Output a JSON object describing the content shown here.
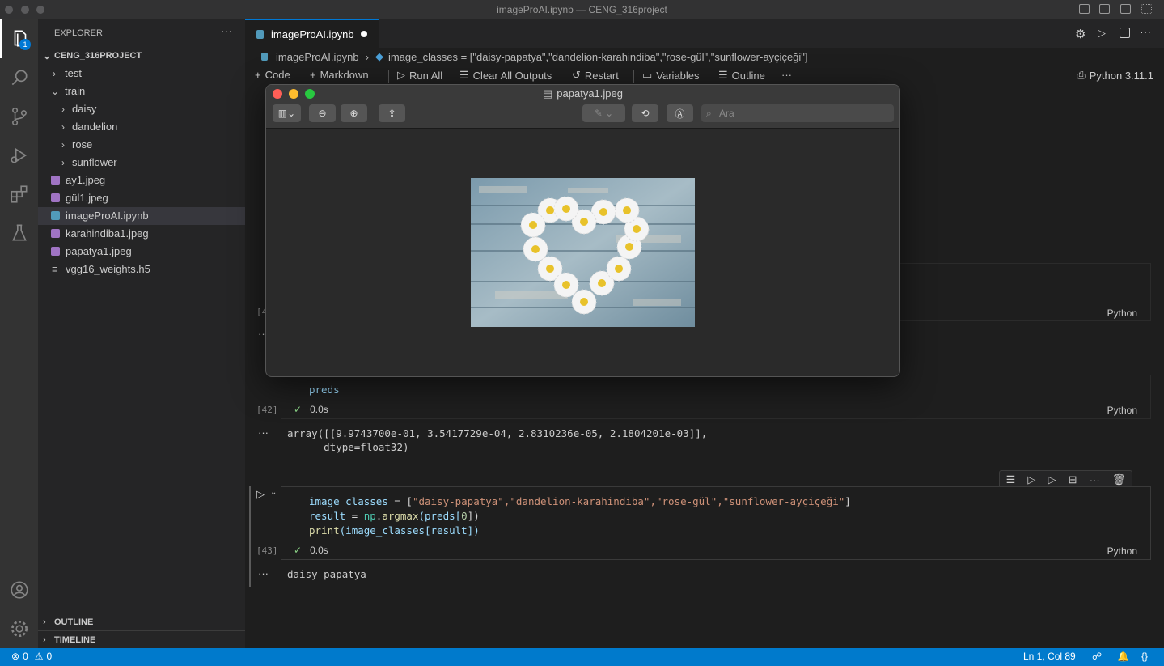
{
  "window": {
    "title": "imageProAI.ipynb — CENG_316project"
  },
  "activity": {
    "explorer_badge": "1"
  },
  "sidebar": {
    "header": "EXPLORER",
    "more": "···",
    "project": "CENG_316PROJECT",
    "items": [
      {
        "label": "test"
      },
      {
        "label": "train"
      },
      {
        "label": "daisy"
      },
      {
        "label": "dandelion"
      },
      {
        "label": "rose"
      },
      {
        "label": "sunflower"
      },
      {
        "label": "ay1.jpeg"
      },
      {
        "label": "gül1.jpeg"
      },
      {
        "label": "imageProAI.ipynb"
      },
      {
        "label": "karahindiba1.jpeg"
      },
      {
        "label": "papatya1.jpeg"
      },
      {
        "label": "vgg16_weights.h5"
      }
    ],
    "outline": "OUTLINE",
    "timeline": "TIMELINE"
  },
  "tab": {
    "label": "imageProAI.ipynb"
  },
  "breadcrumb": {
    "file": "imageProAI.ipynb",
    "symbol": "image_classes = [\"daisy-papatya\",\"dandelion-karahindiba\",\"rose-gül\",\"sunflower-ayçiçeği\"]"
  },
  "toolbar": {
    "code": "Code",
    "markdown": "Markdown",
    "run_all": "Run All",
    "clear": "Clear All Outputs",
    "restart": "Restart",
    "variables": "Variables",
    "outline": "Outline",
    "more": "···",
    "kernel": "Python 3.11.1"
  },
  "cells": {
    "hidden_exec": "[4",
    "lang": "Python",
    "c42": {
      "exec": "[42]",
      "code": "preds",
      "time": "0.0s",
      "output": "array([[9.9743700e-01, 3.5417729e-04, 2.8310236e-05, 2.1804201e-03]],\n      dtype=float32)"
    },
    "c43": {
      "exec": "[43]",
      "time": "0.0s",
      "line1_a": "image_classes",
      "line1_b": " = [",
      "line1_c": "\"daisy-papatya\",\"dandelion-karahindiba\",\"rose-gül\",\"sunflower-ayçiçeği\"",
      "line1_d": "]",
      "line2_a": "result",
      "line2_b": " = ",
      "line2_c": "np",
      "line2_d": ".",
      "line2_e": "argmax",
      "line2_f": "(preds[",
      "line2_g": "0",
      "line2_h": "])",
      "line3_a": "print",
      "line3_b": "(image_classes[result])",
      "output": "daisy-papatya"
    }
  },
  "preview": {
    "title": "papatya1.jpeg",
    "search_placeholder": "Ara"
  },
  "status": {
    "errors": "0",
    "warnings": "0",
    "position": "Ln 1, Col 89"
  }
}
